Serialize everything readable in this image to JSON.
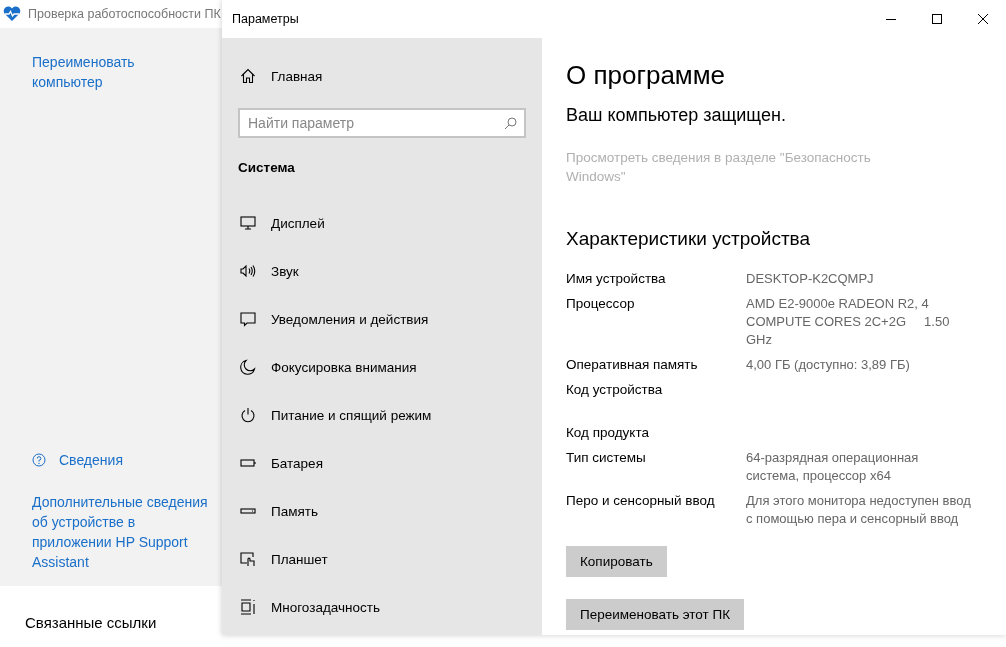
{
  "back_window": {
    "title": "Проверка работоспособности ПК",
    "links": [
      {
        "kind": "link",
        "label": "Переименовать компьютер"
      }
    ],
    "info_link": "Сведения",
    "support_link": "Дополнительные сведения об устройстве в приложении HP Support Assistant",
    "related_heading": "Связанные ссылки"
  },
  "window": {
    "title": "Параметры"
  },
  "sidebar": {
    "home": "Главная",
    "search": {
      "placeholder": "Найти параметр"
    },
    "section": "Система",
    "items": [
      {
        "label": "Дисплей"
      },
      {
        "label": "Звук"
      },
      {
        "label": "Уведомления и действия"
      },
      {
        "label": "Фокусировка внимания"
      },
      {
        "label": "Питание и спящий режим"
      },
      {
        "label": "Батарея"
      },
      {
        "label": "Память"
      },
      {
        "label": "Планшет"
      },
      {
        "label": "Многозадачность"
      }
    ]
  },
  "content": {
    "title": "О программе",
    "status": "Ваш компьютер защищен.",
    "security_link": "Просмотреть сведения в разделе \"Безопасность Windows\"",
    "specs_heading": "Характеристики устройства",
    "specs": [
      {
        "name": "Имя устройства",
        "value": "DESKTOP-K2CQMPJ"
      },
      {
        "name": "Процессор",
        "value": "AMD E2-9000e RADEON R2, 4 COMPUTE CORES 2C+2G     1.50 GHz"
      },
      {
        "name": "Оперативная память",
        "value": "4,00 ГБ (доступно: 3,89 ГБ)"
      },
      {
        "name": "Код устройства"
      },
      {
        "name": "Код продукта"
      },
      {
        "name": "Тип системы",
        "value": "64-разрядная операционная система, процессор x64"
      },
      {
        "name": "Перо и сенсорный ввод",
        "value": "Для этого монитора недоступен ввод с помощью пера и сенсорный ввод"
      }
    ],
    "buttons": [
      "Копировать",
      "Переименовать этот ПК"
    ]
  }
}
